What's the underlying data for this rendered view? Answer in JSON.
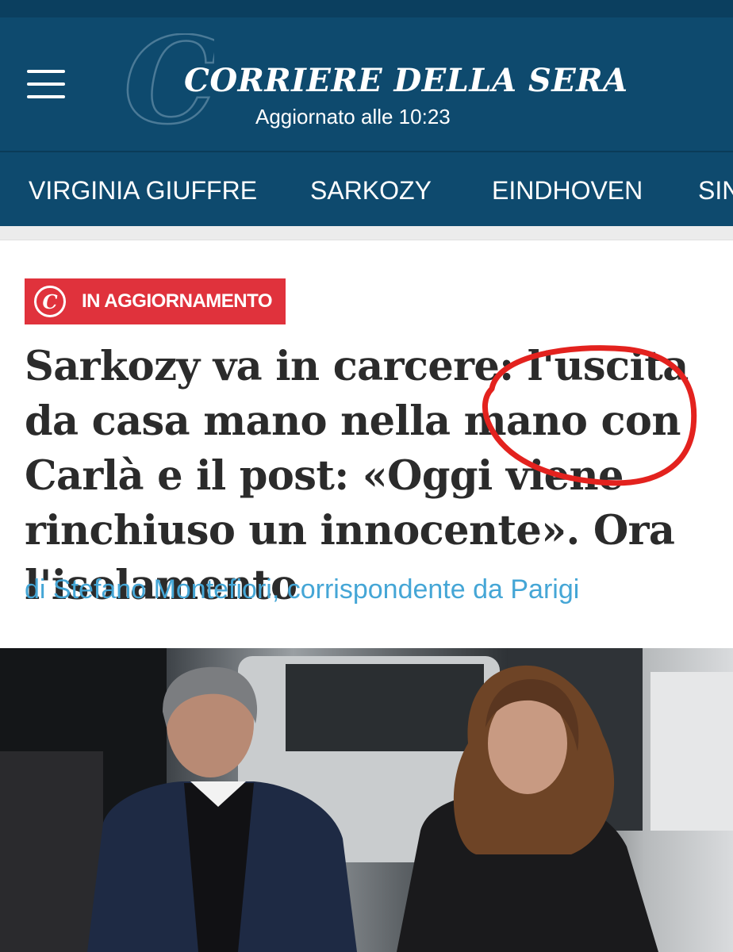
{
  "app": {
    "masthead": "CORRIERE DELLA SERA",
    "logo_letter": "C",
    "updated_text": "Aggiornato alle 10:23",
    "menu_icon": "hamburger-menu-icon"
  },
  "nav": {
    "items": [
      {
        "label": "VIRGINIA GIUFFRE"
      },
      {
        "label": "SARKOZY"
      },
      {
        "label": "EINDHOVEN"
      },
      {
        "label": "SIN"
      }
    ]
  },
  "article": {
    "badge_icon_letter": "C",
    "badge_label": "IN AGGIORNAMENTO",
    "headline": "Sarkozy va in carcere: l'uscita da casa mano nella mano con Carlà e il post: «Oggi viene rinchiuso un innocente». Ora l'isolamento",
    "byline": "di Stefano Montefiori, corrispondente da Parigi"
  },
  "colors": {
    "header_bg": "#0e4a6e",
    "badge_red": "#e0323c",
    "byline_blue": "#45a6d6",
    "annotation_red": "#e3221e"
  }
}
